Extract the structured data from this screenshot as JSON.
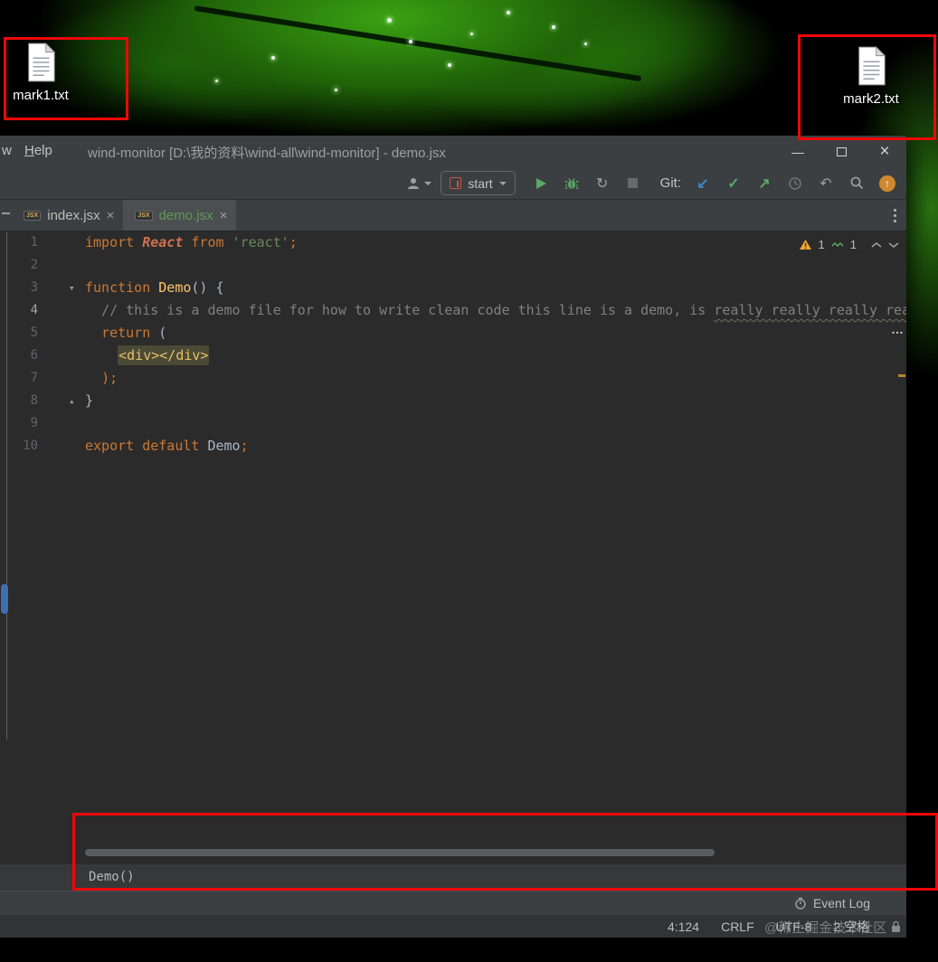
{
  "desktop": {
    "icons": [
      {
        "label": "mark1.txt"
      },
      {
        "label": "mark2.txt"
      }
    ]
  },
  "window": {
    "title": "wind-monitor [D:\\我的资料\\wind-all\\wind-monitor] - demo.jsx",
    "menu": {
      "partial": "w",
      "help": "Help"
    }
  },
  "glyphs": {
    "minimize": "—",
    "close": "×",
    "coverage": "↻",
    "undo": "↶",
    "git_update": "↙",
    "git_commit": "✓",
    "git_push": "↗",
    "update": "↑",
    "ellipsis": "…"
  },
  "toolbar": {
    "run_config": "start",
    "git_label": "Git:"
  },
  "tabs": [
    {
      "icon": "JSX",
      "label": "index.jsx",
      "close": "×"
    },
    {
      "icon": "JSX",
      "label": "demo.jsx",
      "close": "×"
    }
  ],
  "editor": {
    "inspections": {
      "warnings": "1",
      "typos": "1"
    },
    "lines": [
      {
        "num": "1",
        "tokens": [
          {
            "t": "import ",
            "c": "kw"
          },
          {
            "t": "React",
            "c": "imp"
          },
          {
            "t": " ",
            "c": "pl"
          },
          {
            "t": "from ",
            "c": "kw"
          },
          {
            "t": "'react'",
            "c": "str"
          },
          {
            "t": ";",
            "c": "kw"
          }
        ]
      },
      {
        "num": "2",
        "tokens": []
      },
      {
        "num": "3",
        "fold": "▾",
        "tokens": [
          {
            "t": "function ",
            "c": "kw"
          },
          {
            "t": "Demo",
            "c": "fn"
          },
          {
            "t": "() {",
            "c": "pl"
          }
        ]
      },
      {
        "num": "4",
        "current": true,
        "tokens": [
          {
            "t": "  ",
            "c": "pl"
          },
          {
            "t": "// this is a demo file for how to write clean code this line is a demo, is ",
            "c": "cmt"
          },
          {
            "t": "really really really rea",
            "c": "cmt wavy"
          }
        ]
      },
      {
        "num": "5",
        "tokens": [
          {
            "t": "  ",
            "c": "pl"
          },
          {
            "t": "return",
            "c": "kw"
          },
          {
            "t": " (",
            "c": "pl"
          }
        ]
      },
      {
        "num": "6",
        "tokens": [
          {
            "t": "    ",
            "c": "pl"
          },
          {
            "t": "<div></div>",
            "c": "tag"
          }
        ]
      },
      {
        "num": "7",
        "tokens": [
          {
            "t": "  ",
            "c": "pl"
          },
          {
            "t": ");",
            "c": "kw"
          }
        ]
      },
      {
        "num": "8",
        "fold": "▴",
        "tokens": [
          {
            "t": "}",
            "c": "pl"
          }
        ]
      },
      {
        "num": "9",
        "tokens": []
      },
      {
        "num": "10",
        "tokens": [
          {
            "t": "export default ",
            "c": "kw"
          },
          {
            "t": "Demo",
            "c": "pl"
          },
          {
            "t": ";",
            "c": "kw"
          }
        ]
      }
    ]
  },
  "bottom": {
    "breadcrumb": "Demo()"
  },
  "status": {
    "event_log": "Event Log",
    "position": "4:124",
    "line_ending": "CRLF",
    "encoding": "UTF-8",
    "indent": "2 空格"
  },
  "watermark": {
    "text": "@稀土掘金技术社区"
  }
}
